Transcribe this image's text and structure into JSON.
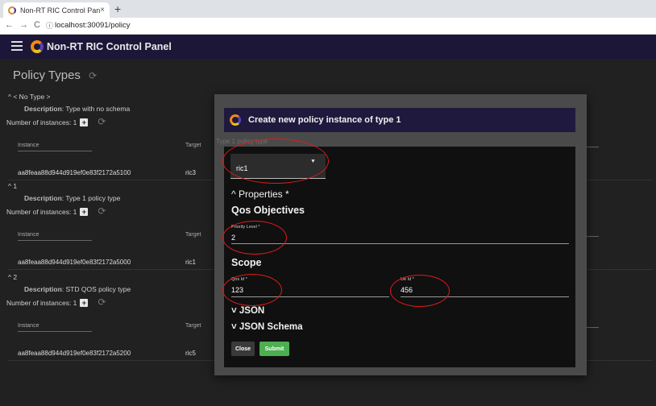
{
  "browser": {
    "tab_title": "Non-RT RIC Control Panel",
    "tab_close": "×",
    "new_tab": "+",
    "url": "localhost:30091/policy",
    "nav_back": "←",
    "nav_forward": "→",
    "nav_reload": "C",
    "info_icon": "ⓘ"
  },
  "app": {
    "title": "Non-RT RIC Control Panel",
    "brand_colors": [
      "#f08a14",
      "#5b3fc2",
      "#e6c21a"
    ]
  },
  "page": {
    "title": "Policy Types",
    "refresh_icon": "⟳"
  },
  "policy_types": [
    {
      "header": "^ < No Type >",
      "description_label": "Description",
      "description": ": Type with no schema",
      "instances_label": "Number of instances: 1",
      "columns": {
        "instance": "Instance",
        "target": "Target"
      },
      "rows": [
        {
          "instance": "aa8feaa88d944d919ef0e83f2172a5100",
          "target": "ric3"
        }
      ]
    },
    {
      "header": "^ 1",
      "description_label": "Description",
      "description": ": Type 1 policy type",
      "instances_label": "Number of instances: 1",
      "columns": {
        "instance": "Instance",
        "target": "Target"
      },
      "rows": [
        {
          "instance": "aa8feaa88d944d919ef0e83f2172a5000",
          "target": "ric1"
        }
      ]
    },
    {
      "header": "^ 2",
      "description_label": "Description",
      "description": ": STD QOS policy type",
      "instances_label": "Number of instances: 1",
      "columns": {
        "instance": "Instance",
        "target": "Target"
      },
      "rows": [
        {
          "instance": "aa8feaa88d944d919ef0e83f2172a5200",
          "target": "ric5"
        }
      ]
    }
  ],
  "dialog": {
    "title": "Create new policy instance of type 1",
    "subtitle": "Type 1 policy type",
    "target_select": {
      "value": "ric1"
    },
    "properties_label": "^ Properties *",
    "qos_heading": "Qos Objectives",
    "priority_level": {
      "label": "Priority Level *",
      "value": "2"
    },
    "scope_heading": "Scope",
    "qos_id": {
      "label": "Qos Id *",
      "value": "123"
    },
    "ue_id": {
      "label": "Ue Id *",
      "value": "456"
    },
    "json_label": "˅ JSON",
    "json_schema_label": "˅ JSON Schema",
    "close_label": "Close",
    "submit_label": "Submit",
    "submit_color": "#4caf50",
    "annotation_color": "#e01b1b"
  }
}
